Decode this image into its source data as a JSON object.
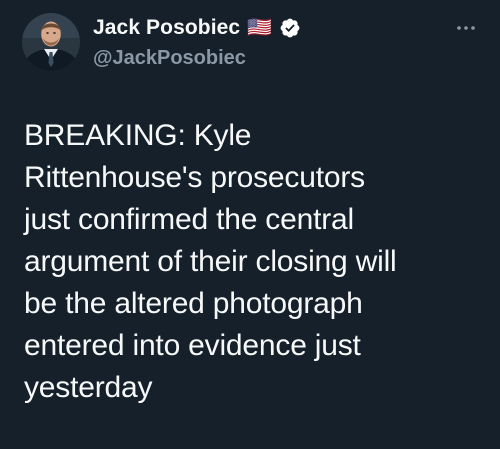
{
  "tweet": {
    "author": {
      "display_name": "Jack Posobiec",
      "flag_emoji": "🇺🇸",
      "handle": "@JackPosobiec",
      "avatar_icon": "avatar-photo",
      "verified_icon": "verified-badge-icon"
    },
    "menu_icon": "more-options-icon",
    "text": "BREAKING: Kyle\nRittenhouse's prosecutors\njust confirmed the central\nargument of their closing will\nbe the altered photograph\nentered into evidence just\nyesterday",
    "colors": {
      "background": "#15202b",
      "primary_text": "#f7f9f9",
      "secondary_text": "#8b98a5",
      "verified_badge": "#ffffff"
    }
  }
}
